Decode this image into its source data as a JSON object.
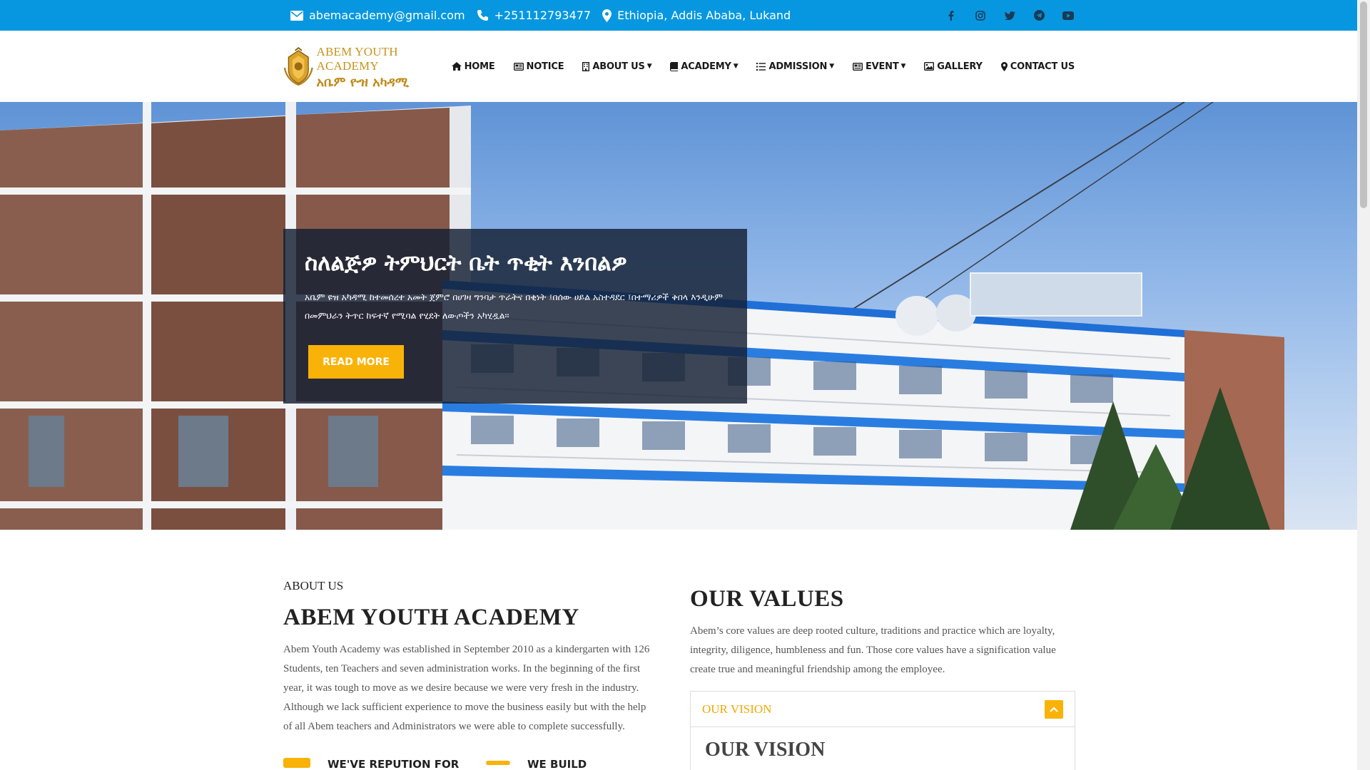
{
  "topbar": {
    "email": "abemacademy@gmail.com",
    "phone": "+251112793477",
    "location": "Ethiopia, Addis Ababa, Lukand",
    "social": [
      "facebook-icon",
      "instagram-icon",
      "twitter-icon",
      "telegram-icon",
      "youtube-icon"
    ]
  },
  "logo": {
    "english": "ABEM YOUTH ACADEMY",
    "amharic": "አቤም ዮዝ አካዳሚ"
  },
  "nav": {
    "items": [
      {
        "label": "HOME",
        "icon": "home-icon",
        "dropdown": false
      },
      {
        "label": "NOTICE",
        "icon": "newspaper-icon",
        "dropdown": false
      },
      {
        "label": "ABOUT US",
        "icon": "building-icon",
        "dropdown": true
      },
      {
        "label": "ACADEMY",
        "icon": "book-icon",
        "dropdown": true
      },
      {
        "label": "ADMISSION",
        "icon": "list-icon",
        "dropdown": true
      },
      {
        "label": "EVENT",
        "icon": "newspaper-icon",
        "dropdown": true
      },
      {
        "label": "GALLERY",
        "icon": "image-icon",
        "dropdown": false
      },
      {
        "label": "CONTACT US",
        "icon": "map-marker-icon",
        "dropdown": false
      }
    ]
  },
  "hero": {
    "title": "ስለልጅዎ ትምህርት ቤት ጥቂት እንበልዎ",
    "text": "አቤም ዩዝ አካዳሚ ከተመሰረተ አመት ጀምሮ በሀገዛ ግንባታ ጥራትና በቂነት ፤በሰው ሀይል አስተዳደር ፤በተማሪዎች ቅበላ እንዲሁም በመምህራን ትጥር ከፍተኛ የሚባል የሂደት ለውጦችን አካሂዷል፡፡",
    "button": "READ MORE"
  },
  "about": {
    "subtitle": "ABOUT US",
    "title": "ABEM YOUTH ACADEMY",
    "text": "Abem Youth Academy was established  in September 2010 as a kindergarten with 126 Students, ten Teachers and seven administration works. In the beginning of the first year, it was tough to move as we desire because we were very fresh in the industry. Although we lack sufficient experience to move the business easily but with the help of all Abem teachers and Administrators we were able to complete successfully.",
    "features": [
      "WE'VE REPUTION FOR",
      "WE BUILD"
    ]
  },
  "values": {
    "title": "OUR VALUES",
    "text": "Abem’s core values are deep rooted culture, traditions and practice which are loyalty, integrity, diligence, humbleness and fun. Those core values have a signification value create true and meaningful friendship among the employee.",
    "accordion": {
      "header": "OUR VISION",
      "body_title": "OUR VISION"
    }
  },
  "colors": {
    "topbar": "#0697e0",
    "accent": "#f9b208",
    "logo_gold": "#c8921e"
  }
}
